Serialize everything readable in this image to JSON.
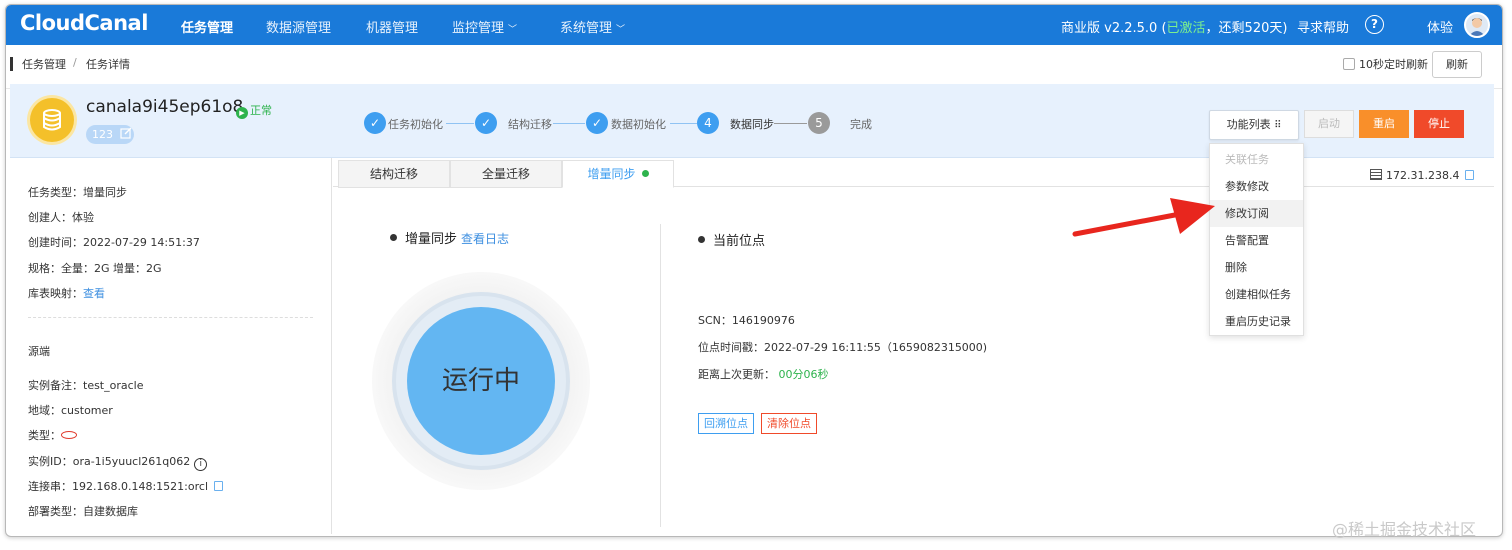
{
  "nav": {
    "logo": "CloudCanal",
    "items": [
      {
        "label": "任务管理",
        "chevron": false
      },
      {
        "label": "数据源管理",
        "chevron": false
      },
      {
        "label": "机器管理",
        "chevron": false
      },
      {
        "label": "监控管理",
        "chevron": true
      },
      {
        "label": "系统管理",
        "chevron": true
      }
    ],
    "edition": "商业版 v2.2.5.0",
    "edition_status_open": "(",
    "edition_activated": "已激活",
    "edition_status_rest": "，还剩520天)",
    "help": "寻求帮助",
    "help_icon": "?",
    "user": "体验"
  },
  "breadcrumb": {
    "items": [
      "任务管理",
      "任务详情"
    ],
    "separator": "/",
    "auto_refresh_label": "10秒定时刷新",
    "refresh_button": "刷新"
  },
  "header": {
    "task_name": "canala9i45ep61o8",
    "status": "正常",
    "tag": "123",
    "steps": [
      {
        "num": "✓",
        "label": "任务初始化",
        "state": "done"
      },
      {
        "num": "✓",
        "label": "结构迁移",
        "state": "done"
      },
      {
        "num": "✓",
        "label": "数据初始化",
        "state": "done"
      },
      {
        "num": "4",
        "label": "数据同步",
        "state": "current"
      },
      {
        "num": "5",
        "label": "完成",
        "state": "pending"
      }
    ],
    "buttons": {
      "func_list": "功能列表",
      "start": "启动",
      "restart": "重启",
      "stop": "停止"
    }
  },
  "sidebar": {
    "task_type": "任务类型：增量同步",
    "creator": "创建人：体验",
    "created_at": "创建时间：2022-07-29 14:51:37",
    "spec": "规格：全量：2G 增量：2G",
    "db_mapping_label": "库表映射：",
    "db_mapping_link": "查看",
    "source_title": "源端",
    "instance_note": "实例备注：test_oracle",
    "region": "地域：customer",
    "type_label": "类型：",
    "instance_id": "实例ID：ora-1i5yuucl261q062",
    "info_icon": "i",
    "conn": "连接串：192.168.0.148:1521:orcl",
    "deploy_type": "部署类型：自建数据库"
  },
  "tabs": [
    "结构迁移",
    "全量迁移",
    "增量同步"
  ],
  "ip": "172.31.238.4",
  "main": {
    "sync_title": "增量同步",
    "view_log": "查看日志",
    "running": "运行中",
    "position_title": "当前位点",
    "scn": "SCN：146190976",
    "timestamp": "位点时间戳：2022-07-29 16:11:55（1659082315000)",
    "since_label": "距离上次更新：",
    "since_value": "00分06秒",
    "rewind_btn": "回溯位点",
    "clear_btn": "清除位点"
  },
  "menu": [
    {
      "label": "关联任务",
      "disabled": true
    },
    {
      "label": "参数修改",
      "disabled": false
    },
    {
      "label": "修改订阅",
      "disabled": false,
      "highlighted": true
    },
    {
      "label": "告警配置",
      "disabled": false
    },
    {
      "label": "删除",
      "disabled": false
    },
    {
      "label": "创建相似任务",
      "disabled": false
    },
    {
      "label": "重启历史记录",
      "disabled": false
    }
  ],
  "watermark": "@稀土掘金技术社区",
  "colors": {
    "nav_bg": "#1a7ad9",
    "primary": "#3e9ef0",
    "success": "#2eb34d",
    "warning": "#f98f2a",
    "danger": "#f04a2a",
    "arrow": "#e8261e"
  }
}
